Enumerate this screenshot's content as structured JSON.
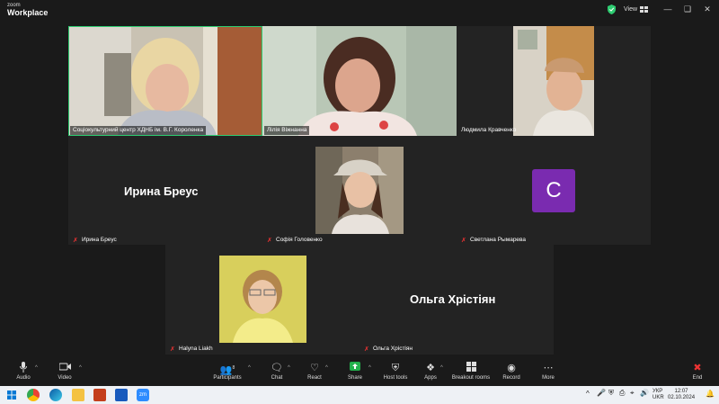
{
  "app": {
    "brand_small": "zoom",
    "brand_large": "Workplace"
  },
  "titlebar": {
    "view_label": "View",
    "controls": [
      "minimize-icon",
      "maximize-icon",
      "close-icon"
    ]
  },
  "participants": {
    "p1": {
      "name": "Соціокультурний центр ХДНБ ім. В.Г. Короленка"
    },
    "p2": {
      "name": "Лілія Віжнанна"
    },
    "p3": {
      "name": "Людмила Кравченко"
    },
    "p4": {
      "name": "Ирина Бреус",
      "display": "Ирина Бреус"
    },
    "p5": {
      "name": "Софія Головенко"
    },
    "p6": {
      "name": "Светлана Рымарева",
      "avatar_letter": "C",
      "avatar_color": "#7a2bb0"
    },
    "p7": {
      "name": "Halyna Liakh"
    },
    "p8": {
      "name": "Ольга Хрістіян",
      "display": "Ольга Хрістіян"
    }
  },
  "toolbar": {
    "audio": "Audio",
    "video": "Video",
    "participants": "Participants",
    "participants_count": "8",
    "chat": "Chat",
    "react": "React",
    "share": "Share",
    "host_tools": "Host tools",
    "apps": "Apps",
    "breakout_rooms": "Breakout rooms",
    "record": "Record",
    "more": "More",
    "end": "End"
  },
  "taskbar": {
    "lang_top": "УКР",
    "lang_bottom": "UKR",
    "time": "12:07",
    "date": "02.10.2024"
  },
  "colors": {
    "active_speaker": "#2ecc71",
    "muted": "#e33333",
    "end": "#e33333",
    "share": "#22b14c"
  }
}
